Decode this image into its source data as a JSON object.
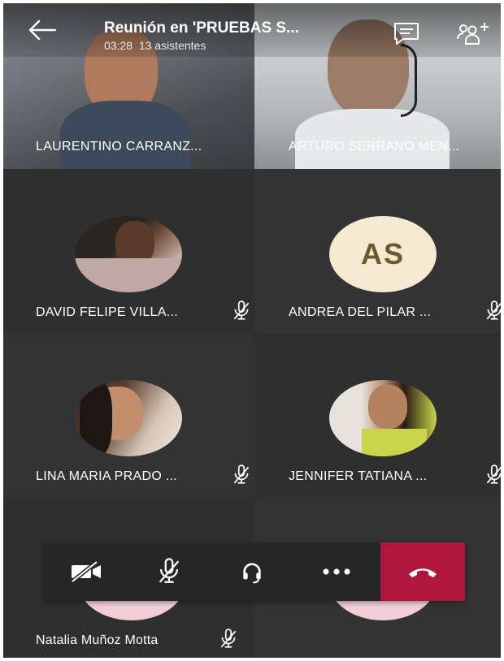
{
  "header": {
    "title": "Reunión en 'PRUEBAS S...",
    "duration": "03:28",
    "attendees": "13 asistentes"
  },
  "participants": [
    {
      "name": "LAURENTINO CARRANZ...",
      "type": "video"
    },
    {
      "name": "ARTURO SERRANO MEN...",
      "type": "video"
    },
    {
      "name": "DAVID FELIPE VILLA...",
      "type": "photo",
      "muted": true
    },
    {
      "name": "ANDREA DEL PILAR ...",
      "type": "initials",
      "initials": "AS",
      "muted": true
    },
    {
      "name": "LINA MARIA PRADO ...",
      "type": "photo",
      "muted": true
    },
    {
      "name": "JENNIFER TATIANA ...",
      "type": "photo",
      "muted": true
    },
    {
      "name": "Natalia Muñoz Motta",
      "type": "photo",
      "muted": true
    },
    {
      "name": "",
      "type": "photo"
    }
  ],
  "controls": {
    "camera": "camera-off-icon",
    "microphone": "microphone-off-icon",
    "audio": "headset-icon",
    "more": "more-options-icon",
    "hangup": "hang-up-icon"
  },
  "colors": {
    "hangup": "#b0173c",
    "tile_background": "#2f2f2f",
    "initials_background": "#f5ead1",
    "initials_text": "#6b5a30"
  }
}
